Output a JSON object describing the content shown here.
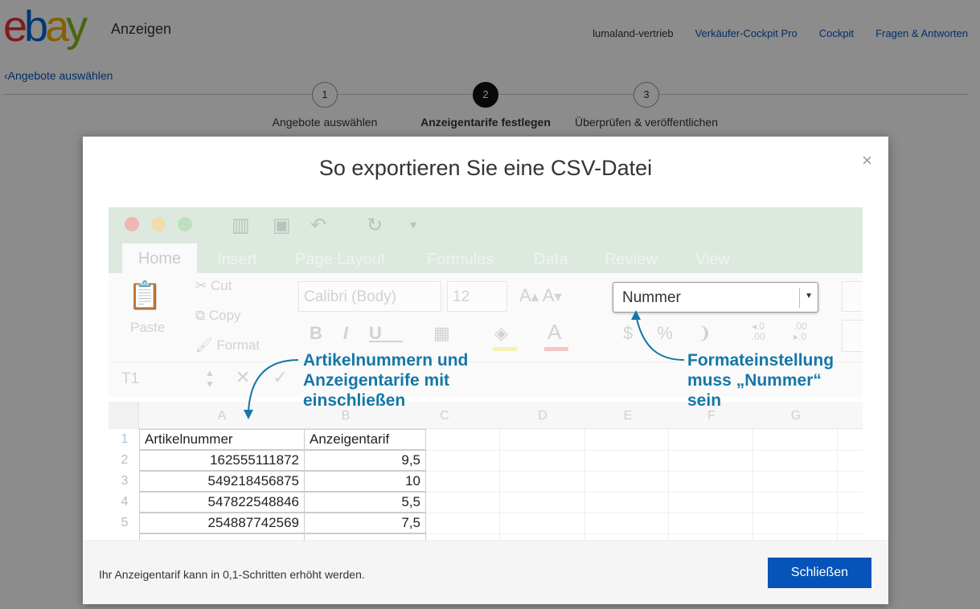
{
  "header": {
    "logo_letters": [
      "e",
      "b",
      "a",
      "y"
    ],
    "app_name": "Anzeigen",
    "user": "lumaland-vertrieb",
    "nav": [
      "Verkäufer-Cockpit Pro",
      "Cockpit",
      "Fragen & Antworten"
    ]
  },
  "back_link": "Angebote auswählen",
  "steps": [
    {
      "number": "1",
      "label": "Angebote auswählen",
      "active": false
    },
    {
      "number": "2",
      "label": "Anzeigentarife festlegen",
      "active": true
    },
    {
      "number": "3",
      "label": "Überprüfen & veröffentlichen",
      "active": false
    }
  ],
  "modal": {
    "title": "So exportieren Sie eine CSV-Datei",
    "close_icon": "×",
    "footer_text": "Ihr Anzeigentarif kann in 0,1-Schritten erhöht werden.",
    "close_button": "Schließen"
  },
  "excel": {
    "tabs": [
      "Home",
      "Insert",
      "Page Layout",
      "Formulas",
      "Data",
      "Review",
      "View"
    ],
    "clipboard": {
      "paste": "Paste",
      "cut": "Cut",
      "copy": "Copy",
      "format": "Format"
    },
    "font_name": "Calibri (Body)",
    "font_size": "12",
    "number_format": "Nummer",
    "cell_ref": "T1",
    "columns": [
      "A",
      "B",
      "C",
      "D",
      "E",
      "F",
      "G"
    ],
    "row_numbers": [
      "1",
      "2",
      "3",
      "4",
      "5"
    ],
    "header": [
      "Artikelnummer",
      "Anzeigentarif"
    ],
    "rows": [
      [
        "162555111872",
        "9,5"
      ],
      [
        "549218456875",
        "10"
      ],
      [
        "547822548846",
        "5,5"
      ],
      [
        "254887742569",
        "7,5"
      ]
    ],
    "annotation_left": [
      "Artikelnummern und",
      "Anzeigentarife mit",
      "einschließen"
    ],
    "annotation_right": [
      "Formateinstellung",
      "muss „Nummer“",
      "sein"
    ]
  },
  "colors": {
    "accent": "#0654ba",
    "annotation": "#1577a8",
    "ribbon": "#dde9df"
  }
}
